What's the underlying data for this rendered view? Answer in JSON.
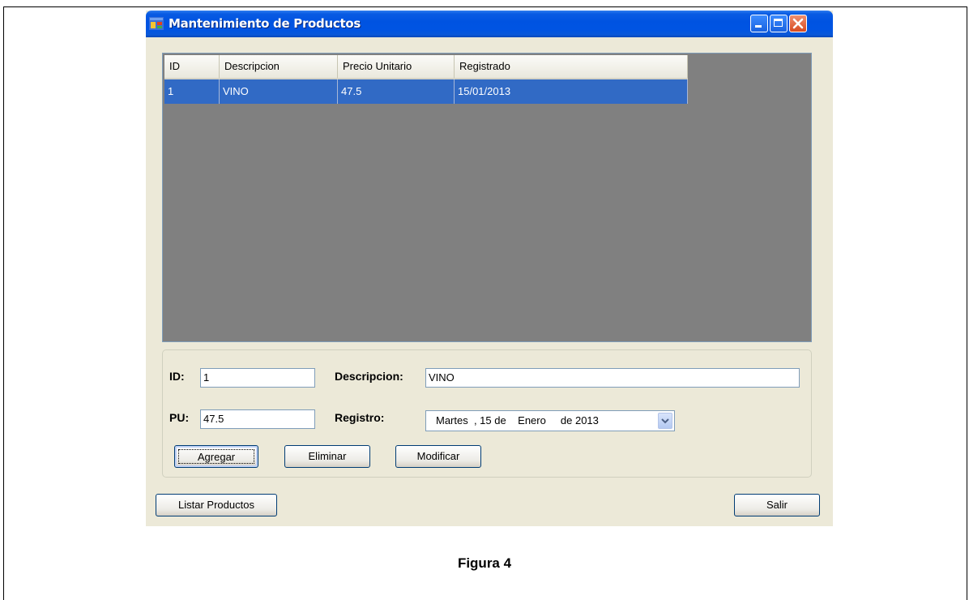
{
  "window": {
    "title": "Mantenimiento de Productos"
  },
  "grid": {
    "columns": [
      "ID",
      "Descripcion",
      "Precio Unitario",
      "Registrado"
    ],
    "rows": [
      [
        "1",
        "VINO",
        "47.5",
        "15/01/2013"
      ]
    ],
    "selected_row_color": "#316ac5"
  },
  "form": {
    "id_label": "ID:",
    "id_value": "1",
    "descripcion_label": "Descripcion:",
    "descripcion_value": "VINO",
    "pu_label": "PU:",
    "pu_value": "47.5",
    "registro_label": "Registro:",
    "registro_date": {
      "day_name": "Martes",
      "day": "15",
      "month": "Enero",
      "year": "2013",
      "text": "Martes  , 15 de    Enero     de 2013"
    }
  },
  "buttons": {
    "agregar": "Agregar",
    "eliminar": "Eliminar",
    "modificar": "Modificar",
    "listar": "Listar Productos",
    "salir": "Salir"
  },
  "caption": "Figura 4",
  "colors": {
    "titlebar": "#0054e3",
    "window_bg": "#ece9d8",
    "grid_bg": "#808080"
  }
}
